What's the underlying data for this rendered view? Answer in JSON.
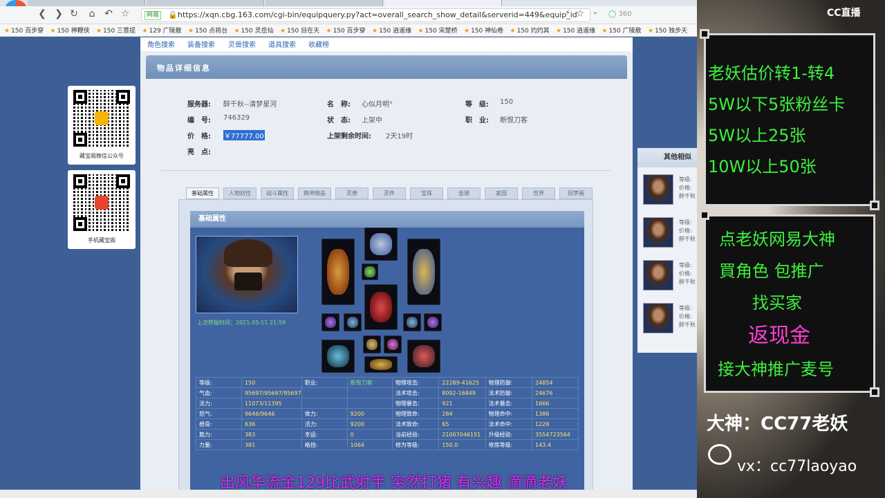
{
  "browser": {
    "url": "https://xqn.cbg.163.com/cgi-bin/equipquery.py?act=overall_search_show_detail&serverid=449&equip_id",
    "url_badge": "网易",
    "search_engine": "360",
    "bookmarks": [
      "150 百步穿",
      "150 神鞭侠",
      "150 三菩提",
      "129 广陵散",
      "150 点将台",
      "150 灵岳仙",
      "150 目在天",
      "150 百步穿",
      "150 逍遥缘",
      "150 宋楚桥",
      "150 神仙卷",
      "150 灼灼其",
      "150 逍遥缘",
      "150 广陵散",
      "150 独步天"
    ]
  },
  "top_nav": [
    "角色搜索",
    "装备搜索",
    "灵兽搜索",
    "道具搜索",
    "收藏榜"
  ],
  "detail": {
    "header": "物品详细信息",
    "server_label": "服务器:",
    "server_value": "醉千秋--清梦星河",
    "name_label": "名　称:",
    "name_value": "心似月明°",
    "level_label": "等　级:",
    "level_value": "150",
    "id_label": "编　号:",
    "id_value": "746329",
    "status_label": "状　态:",
    "status_value": "上架中",
    "job_label": "职　业:",
    "job_value": "断恨刀客",
    "price_label": "价　格:",
    "price_value": "￥77777.00",
    "remaining_label": "上架剩余时间:",
    "remaining_value": "2天19时",
    "highlight_label": "亮　点:"
  },
  "subtabs": [
    "基础属性",
    "人物抗性",
    "战斗属性",
    "携带物品",
    "灵兽",
    "灵件",
    "宝珠",
    "坐骑",
    "家园",
    "世界",
    "旧梦画"
  ],
  "attr_panel": {
    "title": "基础属性",
    "transfer_time": "上次转服时间：2021-05-11 21:59"
  },
  "stats_rows": [
    [
      "等级:",
      "150",
      "职业:",
      "断恨刀客",
      "物理攻击:",
      "22289-41625",
      "物理防御:",
      "24854"
    ],
    [
      "气血:",
      "95697/95697/95697",
      "",
      "",
      "法术攻击:",
      "8092-16849",
      "法术防御:",
      "24676"
    ],
    [
      "法力:",
      "11073/11395",
      "",
      "",
      "物理暴击:",
      "921",
      "法术暴击:",
      "1666"
    ],
    [
      "怒气:",
      "9646/9646",
      "体力:",
      "9200",
      "物理致命:",
      "284",
      "物理命中:",
      "1386"
    ],
    [
      "根骨:",
      "636",
      "活力:",
      "9200",
      "法术致命:",
      "65",
      "法术命中:",
      "1228"
    ],
    [
      "筋力:",
      "383",
      "幸运:",
      "0",
      "当前经验:",
      "21007046151",
      "升级经验:",
      "3554723564"
    ],
    [
      "力量:",
      "381",
      "格挡:",
      "1064",
      "修为等级:",
      "150.0",
      "修炼等级:",
      "143.4"
    ]
  ],
  "side_panel": {
    "title": "其他相似",
    "items": [
      {
        "l1": "等级:",
        "l2": "价格:",
        "l3": "醉千秋"
      },
      {
        "l1": "等级:",
        "l2": "价格:",
        "l3": "醉千秋"
      },
      {
        "l1": "等级:",
        "l2": "价格:",
        "l3": "醉千秋"
      },
      {
        "l1": "等级:",
        "l2": "价格:",
        "l3": "醉千秋"
      }
    ]
  },
  "qr_cards": [
    {
      "caption": "藏宝阁微信公众号"
    },
    {
      "caption": "手机藏宝阁"
    }
  ],
  "stream": {
    "logo": "CC直播",
    "box1": [
      "老妖估价转1-转4",
      "5W以下5张粉丝卡",
      "5W以上25张",
      "10W以上50张"
    ],
    "box2": [
      "点老妖网易大神",
      "買角色 包推广",
      "找买家"
    ],
    "box2_pink": "返现金",
    "box2_last": "接大神推广麦号",
    "dashen": "大神：CC77老妖",
    "wx": "vx：cc77laoyao",
    "ticker": "出风华流金129比武射手 突然打猪 有兴趣 滴滴老妖"
  },
  "colors": {
    "page_bg": "#3d5f96",
    "price_highlight": "#2f6fd0",
    "stream_green": "#3df03d",
    "stream_pink": "#ff3fd6"
  }
}
